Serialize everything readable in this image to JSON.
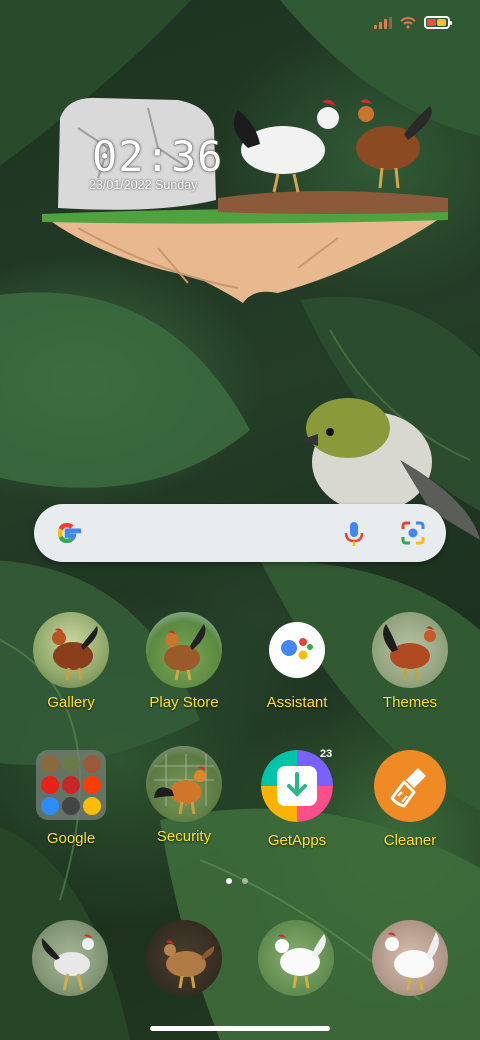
{
  "status_bar": {
    "icons": [
      "signal-icon",
      "wifi-icon",
      "battery-icon"
    ],
    "signal_color": "#e8774c",
    "battery_colors": [
      "#e8513c",
      "#f1c232"
    ]
  },
  "clock_widget": {
    "time": "02:36",
    "date": "23/01/2022 Sunday"
  },
  "search_bar": {
    "icons": [
      "google-logo-icon",
      "microphone-icon",
      "lens-icon"
    ]
  },
  "apps_row1": [
    {
      "label": "Gallery",
      "icon": "rooster-photo-icon"
    },
    {
      "label": "Play Store",
      "icon": "rooster-photo-icon"
    },
    {
      "label": "Assistant",
      "icon": "google-assistant-icon"
    },
    {
      "label": "Themes",
      "icon": "rooster-photo-icon"
    }
  ],
  "apps_row2": [
    {
      "label": "Google",
      "icon": "folder-icon"
    },
    {
      "label": "Security",
      "icon": "rooster-photo-icon"
    },
    {
      "label": "GetApps",
      "icon": "getapps-icon",
      "badge": "23"
    },
    {
      "label": "Cleaner",
      "icon": "broom-icon"
    }
  ],
  "dock": [
    {
      "icon": "rooster-photo-icon"
    },
    {
      "icon": "hen-photo-icon"
    },
    {
      "icon": "white-rooster-photo-icon"
    },
    {
      "icon": "white-rooster-photo-icon"
    }
  ],
  "label_color": "#ffde2e",
  "page_indicator": {
    "pages": 2,
    "current": 1
  }
}
